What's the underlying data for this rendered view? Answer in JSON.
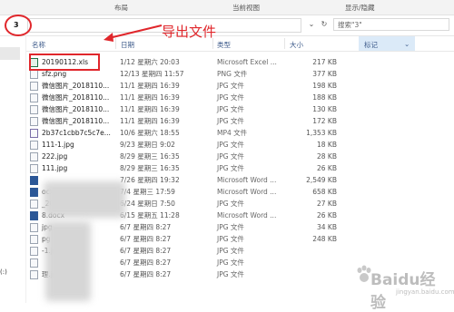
{
  "ribbon": {
    "layout": "布局",
    "current_view": "当前视图",
    "show_hide": "显示/隐藏"
  },
  "address": {
    "value": "3",
    "refresh_icon": "refresh-icon",
    "dropdown_icon": "chevron-down-icon"
  },
  "search": {
    "placeholder": "搜索\"3\""
  },
  "annotation": {
    "label": "导出文件"
  },
  "sidebar": {
    "bottom_label": "(:)"
  },
  "columns": {
    "name": "名称",
    "date": "日期",
    "type": "类型",
    "size": "大小",
    "tags": "标记"
  },
  "files": [
    {
      "name": "20190112.xls",
      "date": "1/12 星期六 20:03",
      "type": "Microsoft Excel ...",
      "size": "217 KB",
      "icon": "excel"
    },
    {
      "name": "sfz.png",
      "date": "12/13 星期四 11:57",
      "type": "PNG 文件",
      "size": "377 KB",
      "icon": "image"
    },
    {
      "name": "微信图片_2018110...",
      "date": "11/1 星期四 16:39",
      "type": "JPG 文件",
      "size": "198 KB",
      "icon": "image"
    },
    {
      "name": "微信图片_2018110...",
      "date": "11/1 星期四 16:39",
      "type": "JPG 文件",
      "size": "188 KB",
      "icon": "image"
    },
    {
      "name": "微信图片_2018110...",
      "date": "11/1 星期四 16:39",
      "type": "JPG 文件",
      "size": "130 KB",
      "icon": "image"
    },
    {
      "name": "微信图片_2018110...",
      "date": "11/1 星期四 16:39",
      "type": "JPG 文件",
      "size": "172 KB",
      "icon": "image"
    },
    {
      "name": "2b37c1cbb7c5c7e...",
      "date": "10/6 星期六 18:55",
      "type": "MP4 文件",
      "size": "1,353 KB",
      "icon": "mp4"
    },
    {
      "name": "111-1.jpg",
      "date": "9/23 星期日 9:02",
      "type": "JPG 文件",
      "size": "18 KB",
      "icon": "image"
    },
    {
      "name": "222.jpg",
      "date": "8/29 星期三 16:35",
      "type": "JPG 文件",
      "size": "28 KB",
      "icon": "image"
    },
    {
      "name": "111.jpg",
      "date": "8/29 星期三 16:35",
      "type": "JPG 文件",
      "size": "26 KB",
      "icon": "image"
    },
    {
      "name": "",
      "date": "7/26 星期四 19:32",
      "type": "Microsoft Word ...",
      "size": "2,549 KB",
      "icon": "word"
    },
    {
      "name": "ocx",
      "date": "7/4 星期三 17:59",
      "type": "Microsoft Word ...",
      "size": "658 KB",
      "icon": "word"
    },
    {
      "name": "_2018062...",
      "date": "6/24 星期日 7:50",
      "type": "JPG 文件",
      "size": "27 KB",
      "icon": "image"
    },
    {
      "name": "8.docx",
      "date": "6/15 星期五 11:28",
      "type": "Microsoft Word ...",
      "size": "26 KB",
      "icon": "word"
    },
    {
      "name": "jpg",
      "date": "6/7 星期四 8:27",
      "type": "JPG 文件",
      "size": "34 KB",
      "icon": "image"
    },
    {
      "name": "pg",
      "date": "6/7 星期四 8:27",
      "type": "JPG 文件",
      "size": "248 KB",
      "icon": "image"
    },
    {
      "name": "-1.jpg",
      "date": "6/7 星期四 8:27",
      "type": "JPG 文件",
      "size": "",
      "icon": "image"
    },
    {
      "name": "",
      "date": "6/7 星期四 8:27",
      "type": "JPG 文件",
      "size": "",
      "icon": "image"
    },
    {
      "name": "理.jpg",
      "date": "6/7 星期四 8:27",
      "type": "JPG 文件",
      "size": "",
      "icon": "image"
    }
  ],
  "watermark": {
    "text": "Baidu经验",
    "sub": "jingyan.baidu.com"
  }
}
